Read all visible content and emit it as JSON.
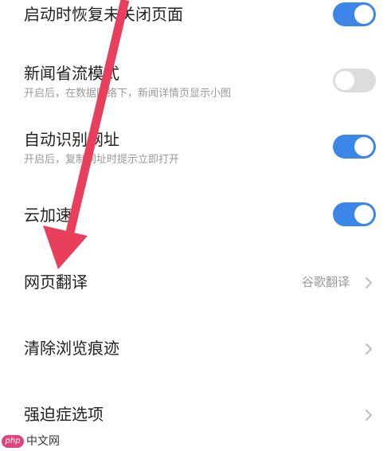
{
  "settings": [
    {
      "title": "启动时恢复未关闭页面",
      "subtitle": "",
      "control": "toggle",
      "on": true
    },
    {
      "title": "新闻省流模式",
      "subtitle": "开启后，在数据网络下，新闻详情页显示小图",
      "control": "toggle",
      "on": false
    },
    {
      "title": "自动识别网址",
      "subtitle": "开启后，复制网址时提示立即打开",
      "control": "toggle",
      "on": true
    },
    {
      "title": "云加速",
      "subtitle": "",
      "control": "toggle",
      "on": true
    },
    {
      "title": "网页翻译",
      "value": "谷歌翻译",
      "control": "chevron"
    },
    {
      "title": "清除浏览痕迹",
      "control": "chevron"
    },
    {
      "title": "强迫症选项",
      "control": "chevron"
    }
  ],
  "colors": {
    "toggle_on": "#3b86e6",
    "toggle_off": "#dcdcdc",
    "arrow": "#e8405c"
  },
  "watermark": {
    "badge": "php",
    "text": "中文网"
  }
}
